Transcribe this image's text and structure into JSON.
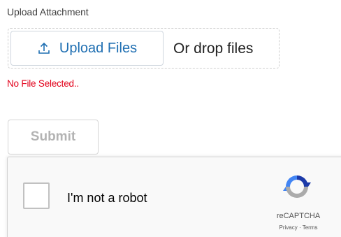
{
  "upload": {
    "label": "Upload Attachment",
    "button_label": "Upload Files",
    "drop_text": "Or drop files",
    "status": "No File Selected.."
  },
  "form": {
    "submit_label": "Submit"
  },
  "recaptcha": {
    "label": "I'm not a robot",
    "brand": "reCAPTCHA",
    "links": "Privacy · Terms",
    "checked": false
  },
  "colors": {
    "accent": "#1f6fb2",
    "error": "#e2001a",
    "disabled_text": "#b3b3b3"
  },
  "icons": {
    "upload": "upload-icon",
    "recaptcha": "recaptcha-logo-icon"
  }
}
